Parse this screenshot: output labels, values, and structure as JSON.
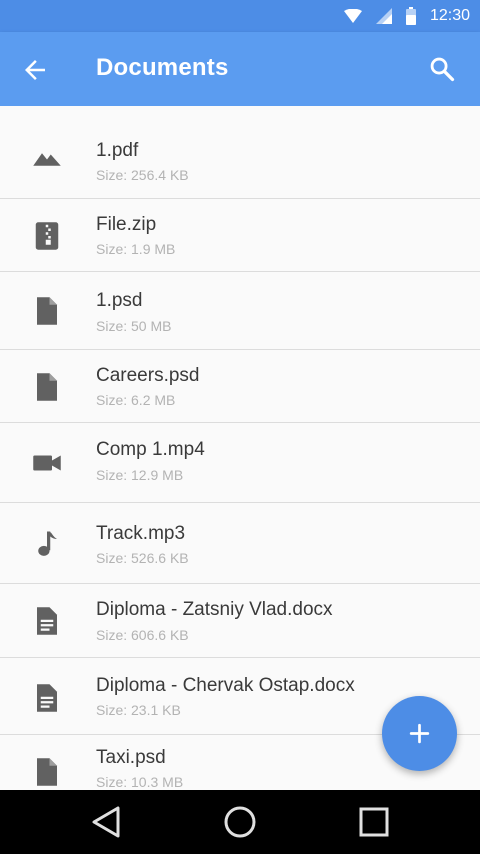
{
  "status_bar": {
    "time": "12:30",
    "icons": [
      "wifi-icon",
      "signal-icon",
      "battery-icon"
    ]
  },
  "app_bar": {
    "title": "Documents",
    "back_icon": "arrow-back-icon",
    "search_icon": "search-icon"
  },
  "files": [
    {
      "name": "1.pdf",
      "size": "Size: 256.4 KB",
      "icon": "image-icon"
    },
    {
      "name": "File.zip",
      "size": "Size: 1.9 MB",
      "icon": "zip-icon"
    },
    {
      "name": "1.psd",
      "size": "Size: 50 MB",
      "icon": "file-icon"
    },
    {
      "name": "Careers.psd",
      "size": "Size: 6.2 MB",
      "icon": "file-icon"
    },
    {
      "name": "Comp 1.mp4",
      "size": "Size: 12.9 MB",
      "icon": "video-icon"
    },
    {
      "name": "Track.mp3",
      "size": "Size: 526.6 KB",
      "icon": "music-note-icon"
    },
    {
      "name": "Diploma - Zatsniy Vlad.docx",
      "size": "Size: 606.6 KB",
      "icon": "document-icon"
    },
    {
      "name": "Diploma - Chervak Ostap.docx",
      "size": "Size: 23.1 KB",
      "icon": "document-icon"
    },
    {
      "name": "Taxi.psd",
      "size": "Size: 10.3 MB",
      "icon": "file-icon"
    }
  ],
  "fab": {
    "icon": "add-icon"
  },
  "colors": {
    "primary": "#5b9cf0",
    "status_bar": "#4d8de6",
    "accent": "#4d8de6",
    "icon_gray": "#616161"
  },
  "nav_bar": {
    "icons": [
      "back-triangle-icon",
      "home-circle-icon",
      "recents-square-icon"
    ]
  }
}
